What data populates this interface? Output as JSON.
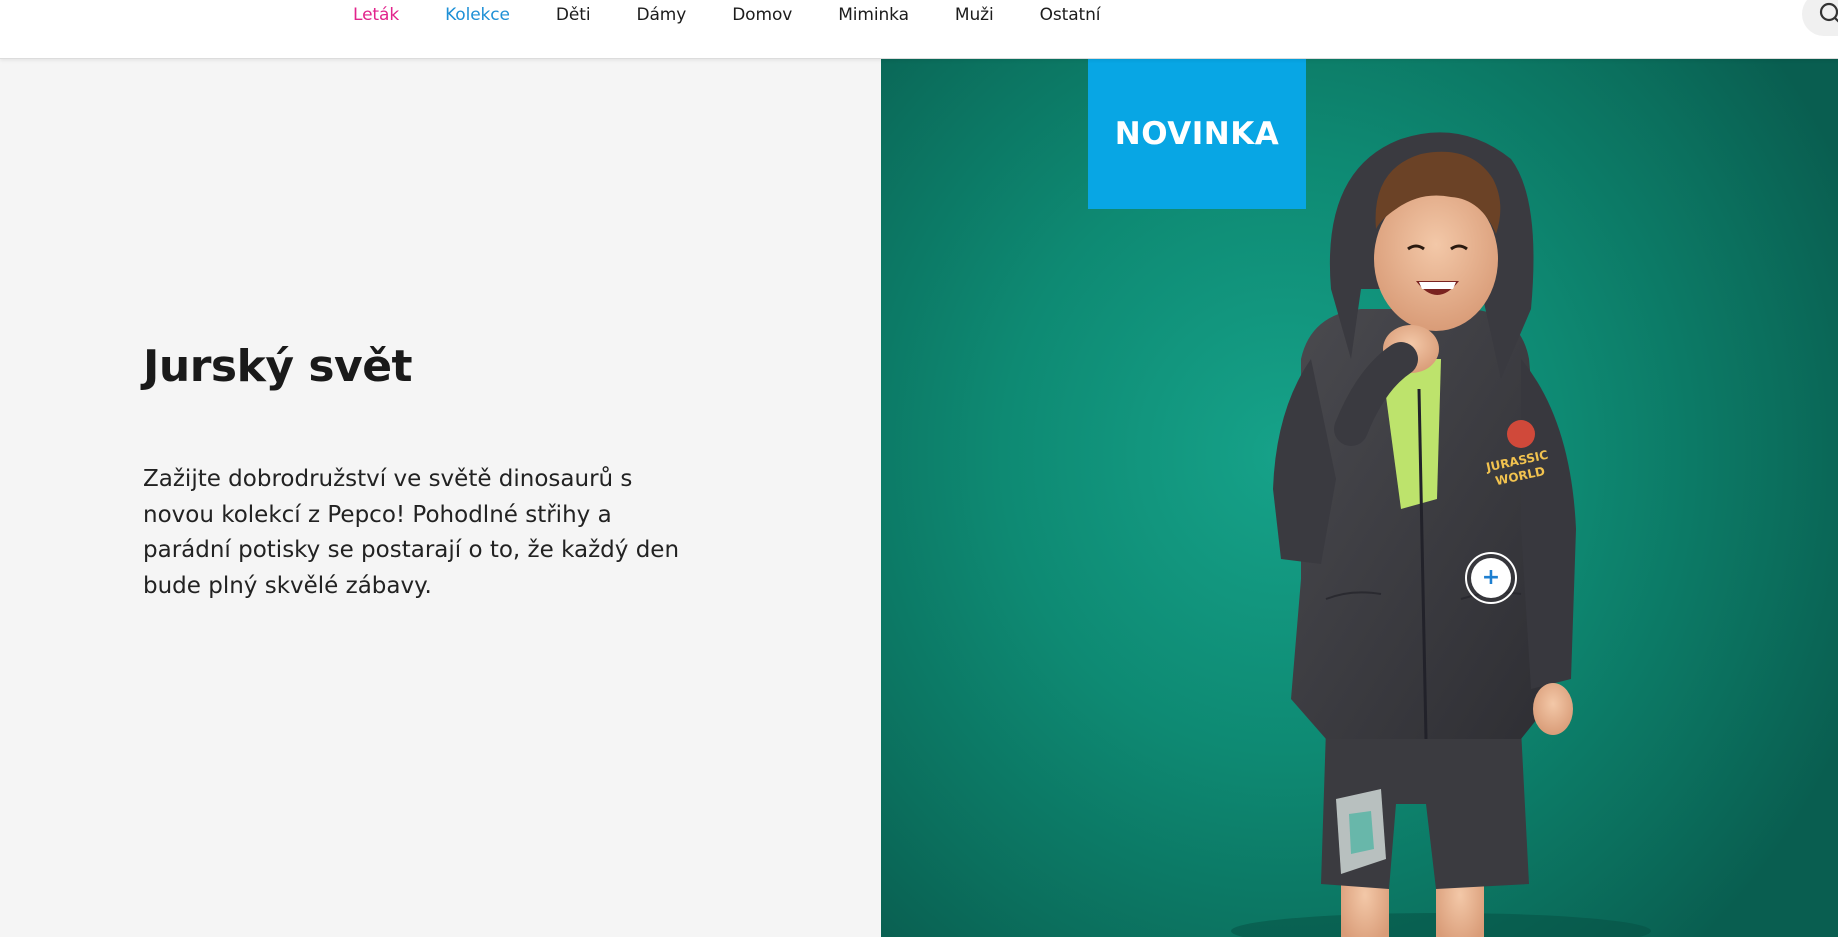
{
  "nav": {
    "items": [
      {
        "label": "Leták"
      },
      {
        "label": "Kolekce"
      },
      {
        "label": "Děti"
      },
      {
        "label": "Dámy"
      },
      {
        "label": "Domov"
      },
      {
        "label": "Miminka"
      },
      {
        "label": "Muži"
      },
      {
        "label": "Ostatní"
      }
    ],
    "active_index": 1,
    "search_icon": "search-icon"
  },
  "hero": {
    "title": "Jurský svět",
    "description": "Zažijte dobrodružství ve světě dinosaurů s novou kolekcí z Pepco! Pohodlné střihy a parádní potisky se postarají o to, že každý den bude plný skvělé zábavy.",
    "badge": "NOVINKA",
    "hotspot_icon": "plus-icon",
    "print_text_line1": "JURASSIC",
    "print_text_line2": "WORLD"
  },
  "colors": {
    "leaflet_link": "#e2248c",
    "active_link": "#1e90d6",
    "badge_bg": "#08a6e4",
    "panel_bg": "#f5f5f5",
    "photo_bg": "#0e8a73"
  }
}
